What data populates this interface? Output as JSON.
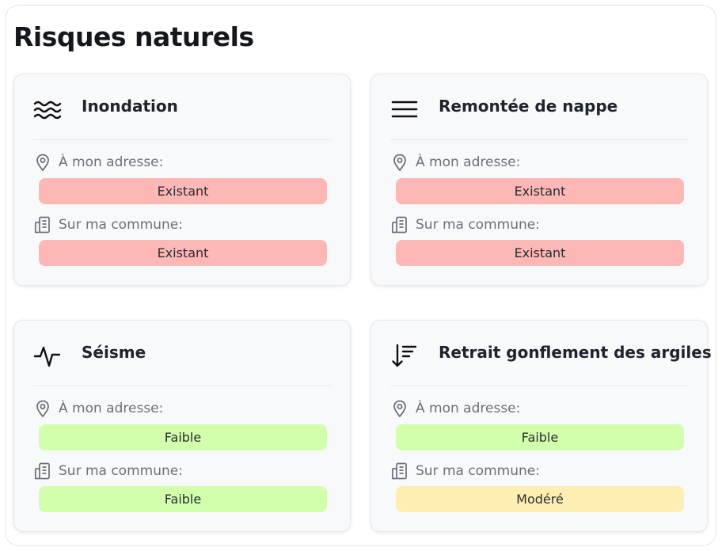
{
  "page": {
    "title": "Risques naturels"
  },
  "labels": {
    "address": "À mon adresse:",
    "commune": "Sur ma commune:"
  },
  "risks": [
    {
      "name": "Inondation",
      "icon": "waves-icon",
      "address_status": "Existant",
      "commune_status": "Existant",
      "address_level": "red",
      "commune_level": "red"
    },
    {
      "name": "Remontée de nappe",
      "icon": "lines-icon",
      "address_status": "Existant",
      "commune_status": "Existant",
      "address_level": "red",
      "commune_level": "red"
    },
    {
      "name": "Séisme",
      "icon": "pulse-icon",
      "address_status": "Faible",
      "commune_status": "Faible",
      "address_level": "green",
      "commune_level": "green"
    },
    {
      "name": "Retrait gonflement des argiles",
      "icon": "sort-descending-icon",
      "address_status": "Faible",
      "commune_status": "Modéré",
      "address_level": "green",
      "commune_level": "yellow"
    }
  ],
  "colors": {
    "red": "#fdb7b5",
    "green": "#d1ffac",
    "yellow": "#fdeeb3"
  }
}
